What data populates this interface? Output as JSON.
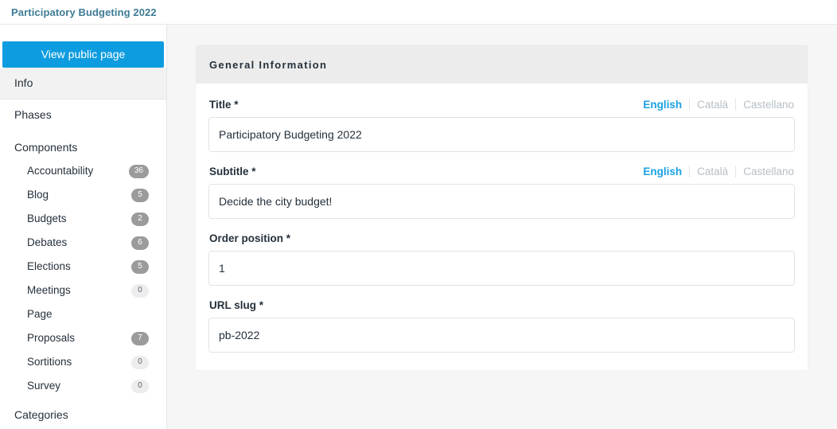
{
  "header": {
    "title": "Participatory Budgeting 2022",
    "title_color": "#3d7c96"
  },
  "sidebar": {
    "public_page_button": "View public page",
    "accent_color": "#0e9ce0",
    "top_items": [
      {
        "label": "Info",
        "active": true
      },
      {
        "label": "Phases",
        "active": false
      }
    ],
    "components_section": {
      "label": "Components",
      "items": [
        {
          "label": "Accountability",
          "count": "36",
          "has_badge": true
        },
        {
          "label": "Blog",
          "count": "5",
          "has_badge": true
        },
        {
          "label": "Budgets",
          "count": "2",
          "has_badge": true
        },
        {
          "label": "Debates",
          "count": "6",
          "has_badge": true
        },
        {
          "label": "Elections",
          "count": "5",
          "has_badge": true
        },
        {
          "label": "Meetings",
          "count": "0",
          "has_badge": true
        },
        {
          "label": "Page",
          "count": "",
          "has_badge": false
        },
        {
          "label": "Proposals",
          "count": "7",
          "has_badge": true
        },
        {
          "label": "Sortitions",
          "count": "0",
          "has_badge": true
        },
        {
          "label": "Survey",
          "count": "0",
          "has_badge": true
        }
      ]
    },
    "categories_section": {
      "label": "Categories"
    }
  },
  "main": {
    "card_title": "General Information",
    "languages": [
      {
        "label": "English",
        "active": true
      },
      {
        "label": "Català",
        "active": false
      },
      {
        "label": "Castellano",
        "active": false
      }
    ],
    "fields": [
      {
        "label": "Title",
        "required": "*",
        "value": "Participatory Budgeting 2022",
        "has_langs": true
      },
      {
        "label": "Subtitle",
        "required": "*",
        "value": "Decide the city budget!",
        "has_langs": true
      },
      {
        "label": "Order position",
        "required": "*",
        "value": "1",
        "has_langs": false
      },
      {
        "label": "URL slug",
        "required": "*",
        "value": "pb-2022",
        "has_langs": false
      }
    ]
  }
}
